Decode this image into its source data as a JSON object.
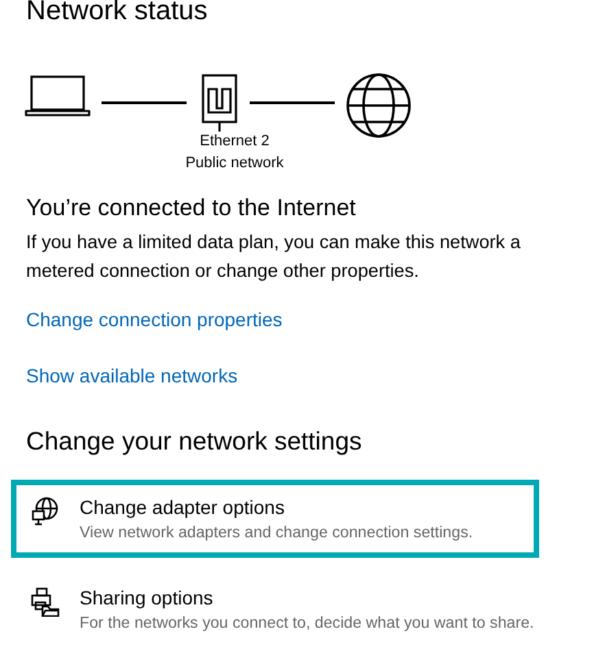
{
  "title": "Network status",
  "diagram": {
    "adapter_name": "Ethernet 2",
    "network_type": "Public network"
  },
  "status": {
    "heading": "You’re connected to the Internet",
    "description": "If you have a limited data plan, you can make this network a metered connection or change other properties."
  },
  "links": [
    "Change connection properties",
    "Show available networks"
  ],
  "section_heading": "Change your network settings",
  "options": [
    {
      "kind": "adapter",
      "title": "Change adapter options",
      "description": "View network adapters and change connection settings.",
      "highlighted": true
    },
    {
      "kind": "sharing",
      "title": "Sharing options",
      "description": "For the networks you connect to, decide what you want to share.",
      "highlighted": false
    }
  ]
}
